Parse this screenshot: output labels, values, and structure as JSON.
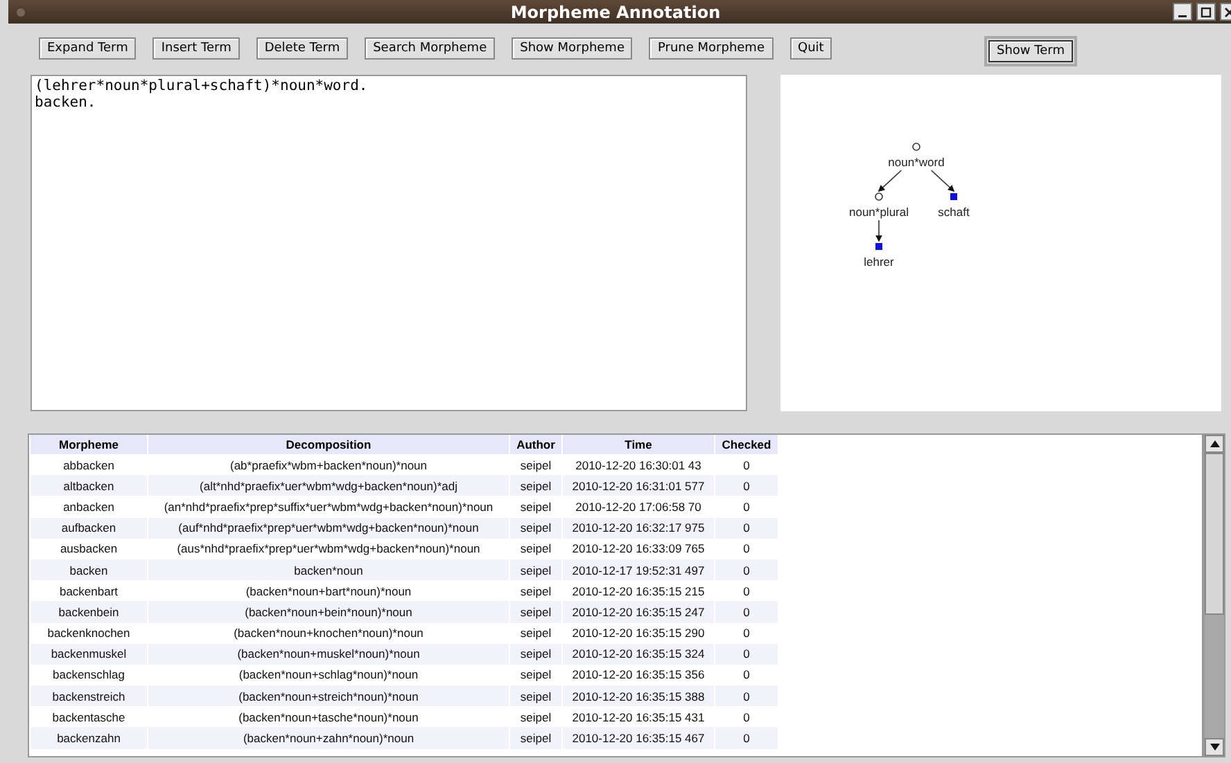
{
  "window": {
    "title": "Morpheme Annotation"
  },
  "toolbar": {
    "buttons": [
      "Expand Term",
      "Insert Term",
      "Delete Term",
      "Search Morpheme",
      "Show Morpheme",
      "Prune Morpheme",
      "Quit"
    ],
    "side_button": "Show Term"
  },
  "editor": {
    "lines": [
      "(lehrer*noun*plural+schaft)*noun*word.",
      "backen."
    ]
  },
  "tree": {
    "label": "noun*word",
    "children": [
      {
        "label": "noun*plural",
        "children": [
          {
            "label": "lehrer"
          }
        ]
      },
      {
        "label": "schaft"
      }
    ]
  },
  "table": {
    "columns": [
      "Morpheme",
      "Decomposition",
      "Author",
      "Time",
      "Checked"
    ],
    "rows": [
      [
        "abbacken",
        "(ab*praefix*wbm+backen*noun)*noun",
        "seipel",
        "2010-12-20 16:30:01 43",
        "0"
      ],
      [
        "altbacken",
        "(alt*nhd*praefix*uer*wbm*wdg+backen*noun)*adj",
        "seipel",
        "2010-12-20 16:31:01 577",
        "0"
      ],
      [
        "anbacken",
        "(an*nhd*praefix*prep*suffix*uer*wbm*wdg+backen*noun)*noun",
        "seipel",
        "2010-12-20 17:06:58 70",
        "0"
      ],
      [
        "aufbacken",
        "(auf*nhd*praefix*prep*uer*wbm*wdg+backen*noun)*noun",
        "seipel",
        "2010-12-20 16:32:17 975",
        "0"
      ],
      [
        "ausbacken",
        "(aus*nhd*praefix*prep*uer*wbm*wdg+backen*noun)*noun",
        "seipel",
        "2010-12-20 16:33:09 765",
        "0"
      ],
      [
        "backen",
        "backen*noun",
        "seipel",
        "2010-12-17 19:52:31 497",
        "0"
      ],
      [
        "backenbart",
        "(backen*noun+bart*noun)*noun",
        "seipel",
        "2010-12-20 16:35:15 215",
        "0"
      ],
      [
        "backenbein",
        "(backen*noun+bein*noun)*noun",
        "seipel",
        "2010-12-20 16:35:15 247",
        "0"
      ],
      [
        "backenknochen",
        "(backen*noun+knochen*noun)*noun",
        "seipel",
        "2010-12-20 16:35:15 290",
        "0"
      ],
      [
        "backenmuskel",
        "(backen*noun+muskel*noun)*noun",
        "seipel",
        "2010-12-20 16:35:15 324",
        "0"
      ],
      [
        "backenschlag",
        "(backen*noun+schlag*noun)*noun",
        "seipel",
        "2010-12-20 16:35:15 356",
        "0"
      ],
      [
        "backenstreich",
        "(backen*noun+streich*noun)*noun",
        "seipel",
        "2010-12-20 16:35:15 388",
        "0"
      ],
      [
        "backentasche",
        "(backen*noun+tasche*noun)*noun",
        "seipel",
        "2010-12-20 16:35:15 431",
        "0"
      ],
      [
        "backenzahn",
        "(backen*noun+zahn*noun)*noun",
        "seipel",
        "2010-12-20 16:35:15 467",
        "0"
      ]
    ]
  }
}
